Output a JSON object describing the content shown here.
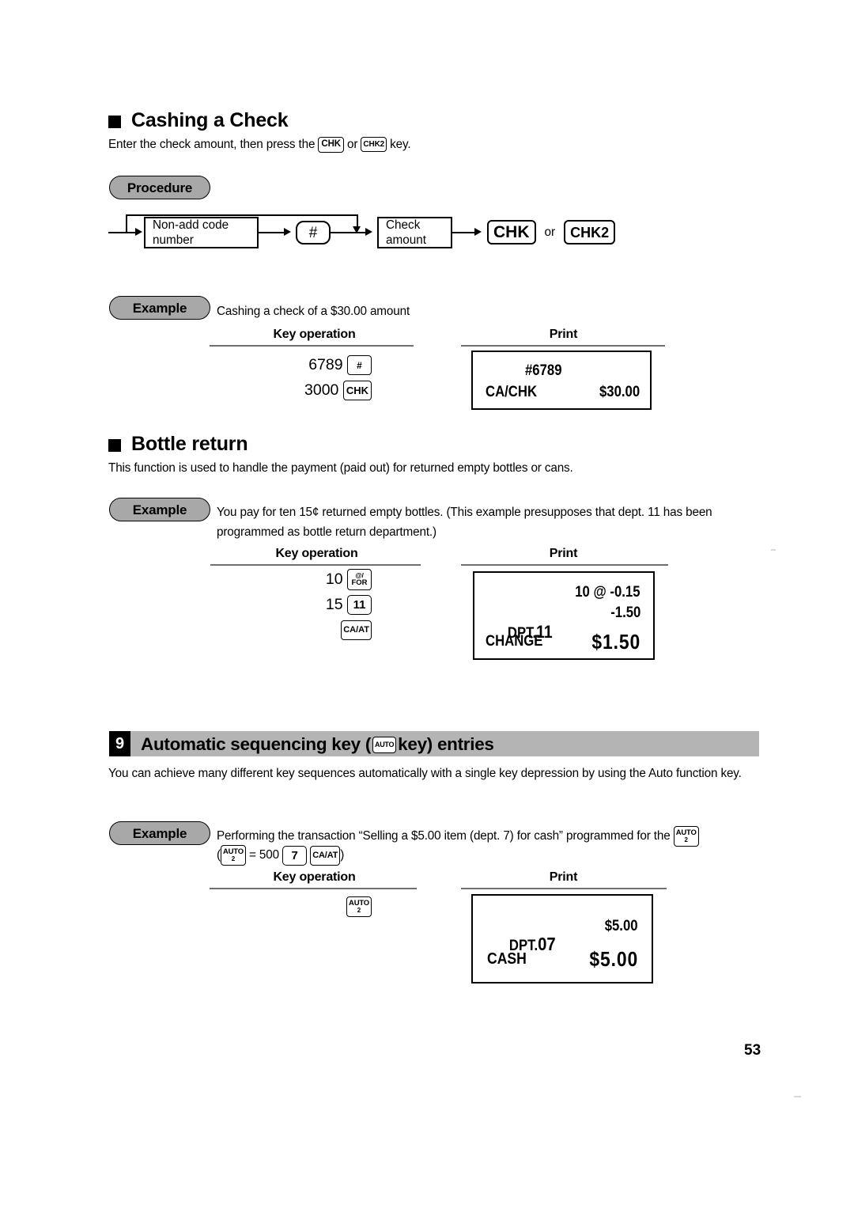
{
  "page": {
    "number": "53"
  },
  "sections": {
    "cashing_check": {
      "heading": "Cashing a Check",
      "intro_before": "Enter the check amount, then press the",
      "intro_mid": "or",
      "intro_after": "key.",
      "key_chk": "CHK",
      "key_chk2": "CHK2",
      "procedure_label": "Procedure",
      "flow": {
        "box_nonadd_line1": "Non-add code",
        "box_nonadd_line2": "number",
        "key_hash": "#",
        "box_check_line1": "Check",
        "box_check_line2": "amount",
        "key_chk": "CHK",
        "or_text": "or",
        "key_chk2": "CHK2"
      },
      "example_label": "Example",
      "example_text": "Cashing a check of a $30.00 amount",
      "col_key_operation": "Key operation",
      "col_print": "Print",
      "key_ops": [
        {
          "amount": "6789",
          "key": "#"
        },
        {
          "amount": "3000",
          "key": "CHK"
        }
      ],
      "receipt": {
        "line_code": "#6789",
        "line_label": "CA/CHK",
        "line_amount": "$30.00"
      }
    },
    "bottle_return": {
      "heading": "Bottle return",
      "body": "This function is used to handle the payment (paid out) for returned empty bottles or cans.",
      "example_label": "Example",
      "example_line1": "You pay for ten 15¢ returned empty bottles. (This example presupposes that dept. 11 has",
      "example_line2": "been programmed as bottle return department.)",
      "col_key_operation": "Key operation",
      "col_print": "Print",
      "key_ops": [
        {
          "amount": "10",
          "key_l1": "@/",
          "key_l2": "FOR"
        },
        {
          "amount": "15",
          "key_l1": "11",
          "key_l2": ""
        },
        {
          "amount": "",
          "key_l1": "CA/AT",
          "key_l2": ""
        }
      ],
      "receipt": {
        "line_qty": "10 @ -0.15",
        "line_dept_label": "DPT.",
        "line_dept_num": "11",
        "line_dept_amount": "-1.50",
        "line_change_label": "CHANGE",
        "line_change_amount": "$1.50"
      }
    },
    "auto_sequencing": {
      "number": "9",
      "title_before": "Automatic sequencing key (",
      "title_key": "AUTO",
      "title_after": "key) entries",
      "body_line1": "You can achieve many different key sequences automatically with a single key depression by using the Auto",
      "body_line2": "function key.",
      "example_label": "Example",
      "example_line1": "Performing the transaction “Selling a $5.00 item (dept. 7) for cash” programmed for the",
      "example_key_auto2_l1": "AUTO",
      "example_key_auto2_l2": "2",
      "example_line2_open": "(",
      "example_line2_equals": "= 500",
      "example_line2_key7": "7",
      "example_line2_keycaat": "CA/AT",
      "example_line2_close": ")",
      "col_key_operation": "Key operation",
      "col_print": "Print",
      "key_op_auto_l1": "AUTO",
      "key_op_auto_l2": "2",
      "receipt": {
        "line_dept_label": "DPT.",
        "line_dept_num": "07",
        "line_dept_amount": "$5.00",
        "line_cash_label": "CASH",
        "line_cash_amount": "$5.00"
      }
    }
  }
}
